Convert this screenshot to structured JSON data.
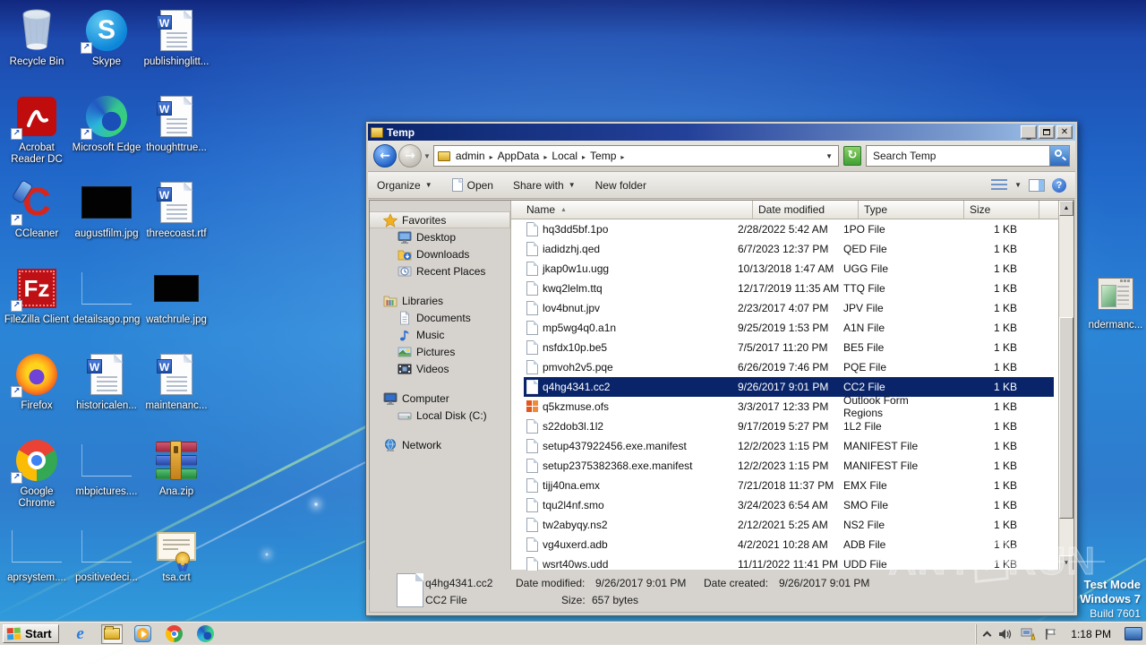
{
  "desktop": {
    "icons": [
      {
        "label": "Recycle Bin",
        "kind": "recycle",
        "shortcut": false
      },
      {
        "label": "Skype",
        "kind": "skype",
        "shortcut": true
      },
      {
        "label": "publishinglitt...",
        "kind": "word",
        "shortcut": false
      },
      {
        "label": "Acrobat Reader DC",
        "kind": "acrobat",
        "shortcut": true
      },
      {
        "label": "Microsoft Edge",
        "kind": "edge",
        "shortcut": true
      },
      {
        "label": "thoughttrue...",
        "kind": "word",
        "shortcut": false
      },
      {
        "label": "CCleaner",
        "kind": "ccleaner",
        "shortcut": true
      },
      {
        "label": "augustfilm.jpg",
        "kind": "black-thumb",
        "shortcut": false
      },
      {
        "label": "threecoast.rtf",
        "kind": "word",
        "shortcut": false
      },
      {
        "label": "FileZilla Client",
        "kind": "filezilla",
        "shortcut": true
      },
      {
        "label": "detailsago.png",
        "kind": "empty-thumb",
        "shortcut": false
      },
      {
        "label": "watchrule.jpg",
        "kind": "black-thumb-small",
        "shortcut": false
      },
      {
        "label": "Firefox",
        "kind": "firefox",
        "shortcut": true
      },
      {
        "label": "historicalen...",
        "kind": "word",
        "shortcut": false
      },
      {
        "label": "maintenanc...",
        "kind": "word",
        "shortcut": false
      },
      {
        "label": "Google Chrome",
        "kind": "chrome",
        "shortcut": true
      },
      {
        "label": "mbpictures....",
        "kind": "empty-thumb",
        "shortcut": false
      },
      {
        "label": "Ana.zip",
        "kind": "rar",
        "shortcut": false
      },
      {
        "label": "aprsystem....",
        "kind": "empty-thumb",
        "shortcut": false
      },
      {
        "label": "positivedeci...",
        "kind": "empty-thumb",
        "shortcut": false
      },
      {
        "label": "tsa.crt",
        "kind": "cert",
        "shortcut": false
      }
    ],
    "right_icon": {
      "label": "ndermanc...",
      "kind": "appwin"
    }
  },
  "explorer": {
    "title": "Temp",
    "breadcrumb": {
      "segments": [
        "admin",
        "AppData",
        "Local",
        "Temp"
      ]
    },
    "search": {
      "value": "Search Temp"
    },
    "toolbar": {
      "organize": "Organize",
      "open": "Open",
      "share_with": "Share with",
      "new_folder": "New folder"
    },
    "sidebar": {
      "sections": [
        {
          "label": "Favorites",
          "icon": "star",
          "selected": true,
          "items": [
            {
              "label": "Desktop",
              "icon": "monitor"
            },
            {
              "label": "Downloads",
              "icon": "downloads"
            },
            {
              "label": "Recent Places",
              "icon": "recent"
            }
          ]
        },
        {
          "label": "Libraries",
          "icon": "library",
          "selected": false,
          "items": [
            {
              "label": "Documents",
              "icon": "document"
            },
            {
              "label": "Music",
              "icon": "music"
            },
            {
              "label": "Pictures",
              "icon": "picture"
            },
            {
              "label": "Videos",
              "icon": "video"
            }
          ]
        },
        {
          "label": "Computer",
          "icon": "computer",
          "selected": false,
          "items": [
            {
              "label": "Local Disk (C:)",
              "icon": "disk"
            }
          ]
        },
        {
          "label": "Network",
          "icon": "network",
          "selected": false,
          "items": []
        }
      ]
    },
    "columns": {
      "name": "Name",
      "date": "Date modified",
      "type": "Type",
      "size": "Size",
      "sort": "asc"
    },
    "files": [
      {
        "name": "hq3dd5bf.1po",
        "date": "2/28/2022 5:42 AM",
        "type": "1PO File",
        "size": "1 KB",
        "icon": "file",
        "selected": false
      },
      {
        "name": "iadidzhj.qed",
        "date": "6/7/2023 12:37 PM",
        "type": "QED File",
        "size": "1 KB",
        "icon": "file",
        "selected": false
      },
      {
        "name": "jkap0w1u.ugg",
        "date": "10/13/2018 1:47 AM",
        "type": "UGG File",
        "size": "1 KB",
        "icon": "file",
        "selected": false
      },
      {
        "name": "kwq2lelm.ttq",
        "date": "12/17/2019 11:35 AM",
        "type": "TTQ File",
        "size": "1 KB",
        "icon": "file",
        "selected": false
      },
      {
        "name": "lov4bnut.jpv",
        "date": "2/23/2017 4:07 PM",
        "type": "JPV File",
        "size": "1 KB",
        "icon": "file",
        "selected": false
      },
      {
        "name": "mp5wg4q0.a1n",
        "date": "9/25/2019 1:53 PM",
        "type": "A1N File",
        "size": "1 KB",
        "icon": "file",
        "selected": false
      },
      {
        "name": "nsfdx10p.be5",
        "date": "7/5/2017 11:20 PM",
        "type": "BE5 File",
        "size": "1 KB",
        "icon": "file",
        "selected": false
      },
      {
        "name": "pmvoh2v5.pqe",
        "date": "6/26/2019 7:46 PM",
        "type": "PQE File",
        "size": "1 KB",
        "icon": "file",
        "selected": false
      },
      {
        "name": "q4hg4341.cc2",
        "date": "9/26/2017 9:01 PM",
        "type": "CC2 File",
        "size": "1 KB",
        "icon": "file",
        "selected": true
      },
      {
        "name": "q5kzmuse.ofs",
        "date": "3/3/2017 12:33 PM",
        "type": "Outlook Form Regions",
        "size": "1 KB",
        "icon": "office",
        "selected": false
      },
      {
        "name": "s22dob3l.1l2",
        "date": "9/17/2019 5:27 PM",
        "type": "1L2 File",
        "size": "1 KB",
        "icon": "file",
        "selected": false
      },
      {
        "name": "setup437922456.exe.manifest",
        "date": "12/2/2023 1:15 PM",
        "type": "MANIFEST File",
        "size": "1 KB",
        "icon": "file",
        "selected": false
      },
      {
        "name": "setup2375382368.exe.manifest",
        "date": "12/2/2023 1:15 PM",
        "type": "MANIFEST File",
        "size": "1 KB",
        "icon": "file",
        "selected": false
      },
      {
        "name": "tijj40na.emx",
        "date": "7/21/2018 11:37 PM",
        "type": "EMX File",
        "size": "1 KB",
        "icon": "file",
        "selected": false
      },
      {
        "name": "tqu2l4nf.smo",
        "date": "3/24/2023 6:54 AM",
        "type": "SMO File",
        "size": "1 KB",
        "icon": "file",
        "selected": false
      },
      {
        "name": "tw2abyqy.ns2",
        "date": "2/12/2021 5:25 AM",
        "type": "NS2 File",
        "size": "1 KB",
        "icon": "file",
        "selected": false
      },
      {
        "name": "vg4uxerd.adb",
        "date": "4/2/2021 10:28 AM",
        "type": "ADB File",
        "size": "1 KB",
        "icon": "file",
        "selected": false
      },
      {
        "name": "wsrt40ws.udd",
        "date": "11/11/2022 11:41 PM",
        "type": "UDD File",
        "size": "1 KB",
        "icon": "file",
        "selected": false
      }
    ],
    "details": {
      "name": "q4hg4341.cc2",
      "type": "CC2 File",
      "modified_label": "Date modified:",
      "modified": "9/26/2017 9:01 PM",
      "created_label": "Date created:",
      "created": "9/26/2017 9:01 PM",
      "size_label": "Size:",
      "size": "657 bytes"
    }
  },
  "taskbar": {
    "start_label": "Start",
    "quick_launch": [
      "internet-explorer",
      "windows-explorer",
      "media-player",
      "chrome",
      "edge"
    ],
    "tray_icons": [
      "collapse-chevron",
      "volume",
      "network-warning",
      "action-center-flag"
    ],
    "clock": "1:18 PM"
  },
  "overlay": {
    "watermark_left": "ANY",
    "watermark_right": "RUN",
    "test_mode_line1": "Test Mode",
    "test_mode_line2": "Windows 7",
    "test_mode_line3": "Build 7601"
  },
  "colors": {
    "selection": "#0a246a",
    "titlebar_left": "#0a246a",
    "titlebar_right": "#a6caf0",
    "desktop_blue": "#2b85d6",
    "chrome_gray": "#d6d3ce"
  }
}
